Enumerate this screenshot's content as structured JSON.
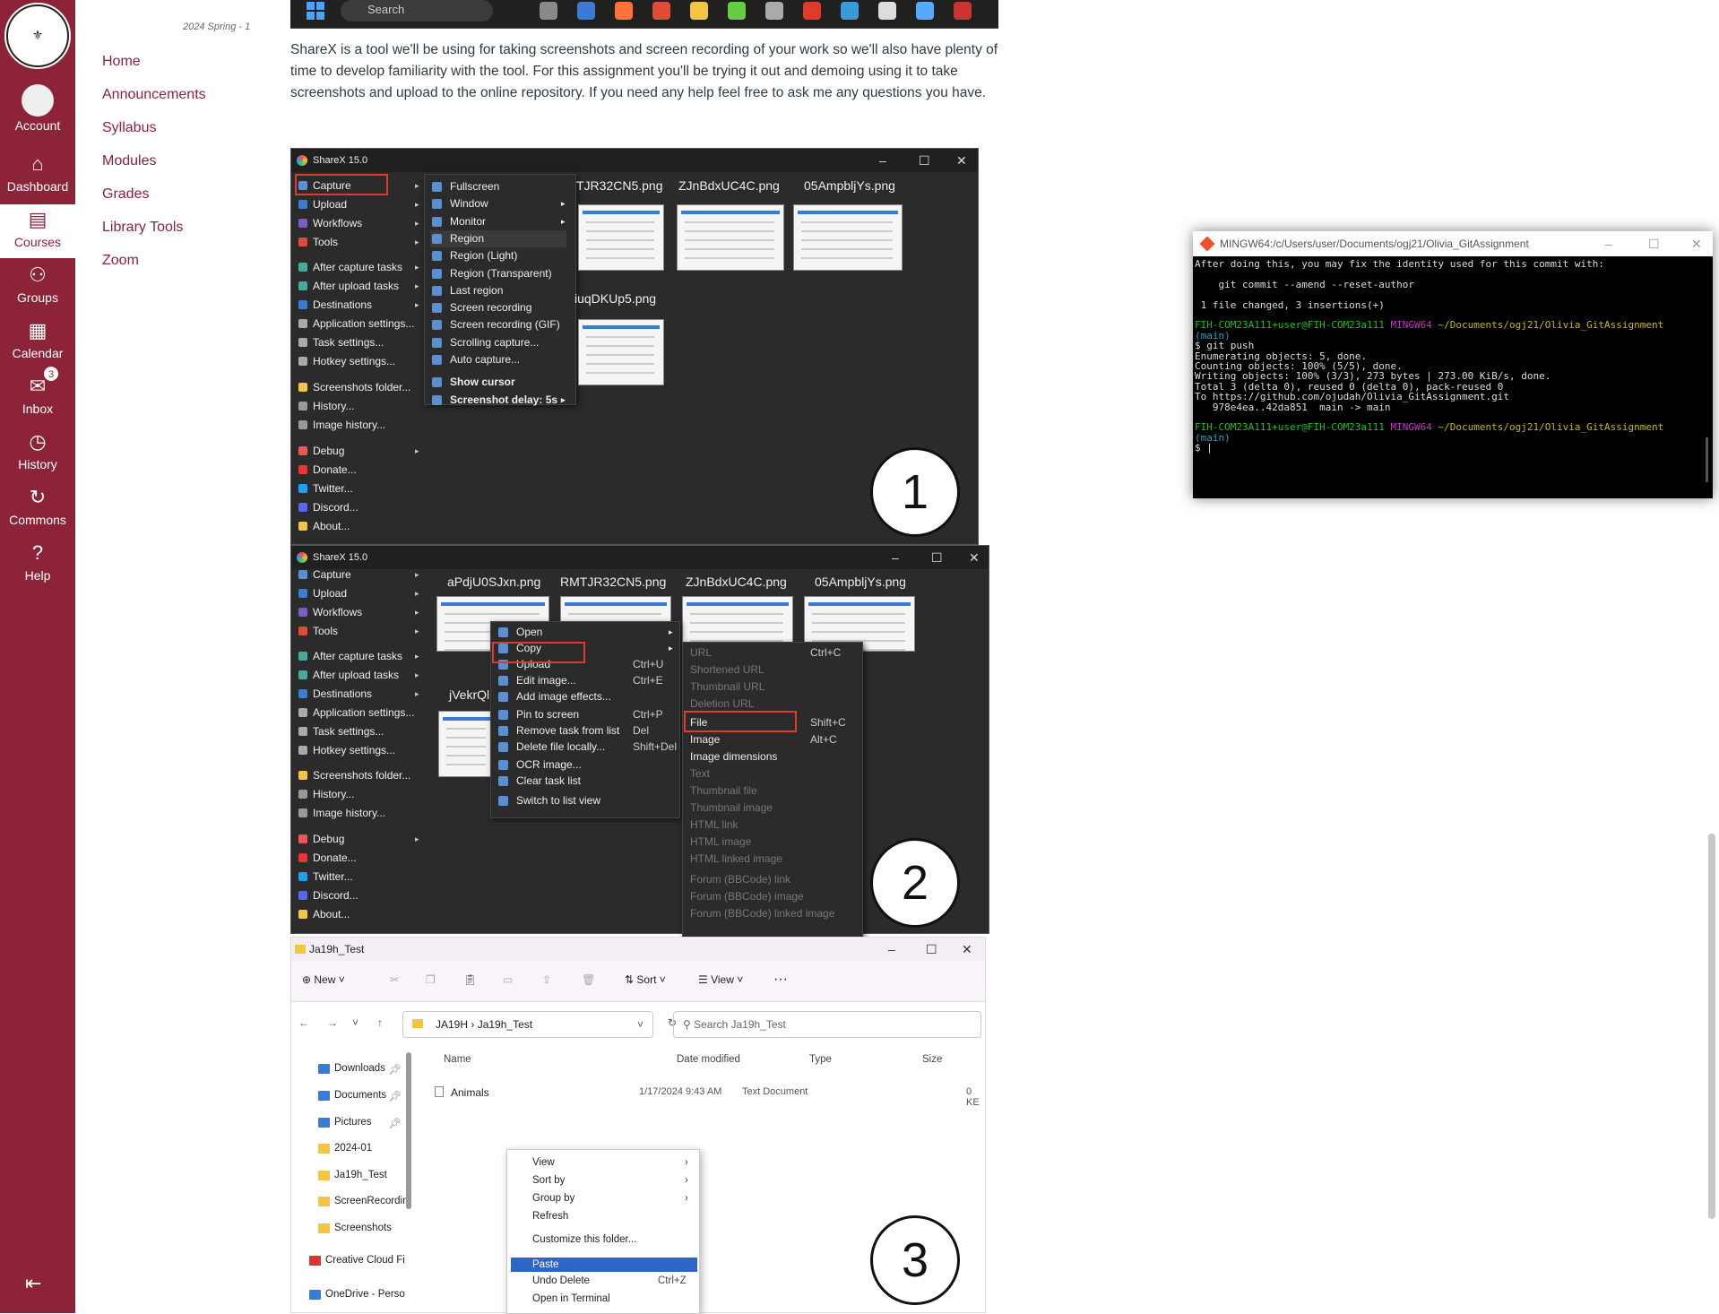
{
  "global_nav": {
    "items": [
      {
        "label": "Account",
        "icon": "account-icon"
      },
      {
        "label": "Dashboard",
        "icon": "dashboard-icon"
      },
      {
        "label": "Courses",
        "icon": "courses-icon"
      },
      {
        "label": "Groups",
        "icon": "groups-icon"
      },
      {
        "label": "Calendar",
        "icon": "calendar-icon"
      },
      {
        "label": "Inbox",
        "icon": "inbox-icon",
        "badge": "3"
      },
      {
        "label": "History",
        "icon": "history-icon"
      },
      {
        "label": "Commons",
        "icon": "commons-icon"
      },
      {
        "label": "Help",
        "icon": "help-icon"
      }
    ],
    "brand_color": "#8c2338"
  },
  "course_nav": {
    "term": "2024 Spring - 1",
    "links": [
      "Home",
      "Announcements",
      "Syllabus",
      "Modules",
      "Grades",
      "Library Tools",
      "Zoom"
    ]
  },
  "taskbar": {
    "search": "Search"
  },
  "intro": "ShareX is a tool we'll be using for taking screenshots and screen recording of your work so we'll also have plenty of time to develop familiarity with the tool. For this assignment you'll be trying it out and demoing using it to take screenshots and upload to the online repository. If you need any help feel free to ask me any questions you have.",
  "sharex1": {
    "title": "ShareX 15.0",
    "menu": [
      "Capture",
      "Upload",
      "Workflows",
      "Tools",
      "After capture tasks",
      "After upload tasks",
      "Destinations",
      "Application settings...",
      "Task settings...",
      "Hotkey settings...",
      "Screenshots folder...",
      "History...",
      "Image history...",
      "Debug",
      "Donate...",
      "Twitter...",
      "Discord...",
      "About..."
    ],
    "submenu": [
      "Fullscreen",
      "Window",
      "Monitor",
      "Region",
      "Region (Light)",
      "Region (Transparent)",
      "Last region",
      "Screen recording",
      "Screen recording (GIF)",
      "Scrolling capture...",
      "Auto capture...",
      "Show cursor",
      "Screenshot delay: 5s"
    ],
    "thumbs": [
      "TJR32CN5.png",
      "ZJnBdxUC4C.png",
      "05AmpbljYs.png",
      "iuqDKUp5.png"
    ],
    "number": "1"
  },
  "sharex2": {
    "title": "ShareX 15.0",
    "thumbs": [
      "aPdjU0SJxn.png",
      "RMTJR32CN5.png",
      "ZJnBdxUC4C.png",
      "05AmpbljYs.png",
      "jVekrQl"
    ],
    "context": [
      {
        "label": "Open",
        "sc": ""
      },
      {
        "label": "Copy",
        "sc": ""
      },
      {
        "label": "Upload",
        "sc": "Ctrl+U"
      },
      {
        "label": "Edit image...",
        "sc": "Ctrl+E"
      },
      {
        "label": "Add image effects...",
        "sc": ""
      },
      {
        "label": "Pin to screen",
        "sc": "Ctrl+P"
      },
      {
        "label": "Remove task from list",
        "sc": "Del"
      },
      {
        "label": "Delete file locally...",
        "sc": "Shift+Del"
      },
      {
        "label": "OCR image...",
        "sc": ""
      },
      {
        "label": "Clear task list",
        "sc": ""
      },
      {
        "label": "Switch to list view",
        "sc": ""
      }
    ],
    "copy_sub": [
      {
        "label": "URL",
        "sc": "Ctrl+C",
        "dis": true
      },
      {
        "label": "Shortened URL",
        "sc": "",
        "dis": true
      },
      {
        "label": "Thumbnail URL",
        "sc": "",
        "dis": true
      },
      {
        "label": "Deletion URL",
        "sc": "",
        "dis": true
      },
      {
        "label": "File",
        "sc": "Shift+C",
        "dis": false
      },
      {
        "label": "Image",
        "sc": "Alt+C",
        "dis": false
      },
      {
        "label": "Image dimensions",
        "sc": "",
        "dis": false
      },
      {
        "label": "Text",
        "sc": "",
        "dis": true
      },
      {
        "label": "Thumbnail file",
        "sc": "",
        "dis": true
      },
      {
        "label": "Thumbnail image",
        "sc": "",
        "dis": true
      },
      {
        "label": "HTML link",
        "sc": "",
        "dis": true
      },
      {
        "label": "HTML image",
        "sc": "",
        "dis": true
      },
      {
        "label": "HTML linked image",
        "sc": "",
        "dis": true
      },
      {
        "label": "Forum (BBCode) link",
        "sc": "",
        "dis": true
      },
      {
        "label": "Forum (BBCode) image",
        "sc": "",
        "dis": true
      },
      {
        "label": "Forum (BBCode) linked image",
        "sc": "",
        "dis": true
      }
    ],
    "number": "2"
  },
  "explorer": {
    "title": "Ja19h_Test",
    "toolbar": {
      "new": "New",
      "sort": "Sort",
      "view": "View"
    },
    "path": [
      "JA19H",
      "Ja19h_Test"
    ],
    "search": "Search Ja19h_Test",
    "nav": [
      "Downloads",
      "Documents",
      "Pictures",
      "2024-01",
      "Ja19h_Test",
      "ScreenRecordin",
      "Screenshots",
      "Creative Cloud Fi",
      "OneDrive - Perso"
    ],
    "columns": [
      "Name",
      "Date modified",
      "Type",
      "Size"
    ],
    "row": {
      "name": "Animals",
      "date": "1/17/2024 9:43 AM",
      "type": "Text Document",
      "size": "0 KE"
    },
    "context": [
      {
        "label": "View",
        "sc": "›"
      },
      {
        "label": "Sort by",
        "sc": "›"
      },
      {
        "label": "Group by",
        "sc": "›"
      },
      {
        "label": "Refresh",
        "sc": ""
      },
      {
        "label": "Customize this folder...",
        "sc": ""
      },
      {
        "label": "Paste",
        "sc": ""
      },
      {
        "label": "Undo Delete",
        "sc": "Ctrl+Z"
      },
      {
        "label": "Open in Terminal",
        "sc": ""
      }
    ],
    "number": "3"
  },
  "terminal": {
    "title": "MINGW64:/c/Users/user/Documents/ogj21/Olivia_GitAssignment",
    "lines": [
      {
        "t": "After doing this, you may fix the identity used for this commit with:",
        "c": ""
      },
      {
        "t": "",
        "c": ""
      },
      {
        "t": "    git commit --amend --reset-author",
        "c": ""
      },
      {
        "t": "",
        "c": ""
      },
      {
        "t": " 1 file changed, 3 insertions(+)",
        "c": ""
      },
      {
        "t": "",
        "c": ""
      },
      {
        "t": "FIH-COM23A111+user@FIH-COM23a111",
        "c": "g",
        "t2": " MINGW64",
        "c2": "m",
        "t3": " ~/Documents/ogj21/Olivia_GitAssignment",
        "c3": "y"
      },
      {
        "t": "(main)",
        "c": "c"
      },
      {
        "t": "$ git push",
        "c": ""
      },
      {
        "t": "Enumerating objects: 5, done.",
        "c": ""
      },
      {
        "t": "Counting objects: 100% (5/5), done.",
        "c": ""
      },
      {
        "t": "Writing objects: 100% (3/3), 273 bytes | 273.00 KiB/s, done.",
        "c": ""
      },
      {
        "t": "Total 3 (delta 0), reused 0 (delta 0), pack-reused 0",
        "c": ""
      },
      {
        "t": "To https://github.com/ojudah/Olivia_GitAssignment.git",
        "c": ""
      },
      {
        "t": "   978e4ea..42da851  main -> main",
        "c": ""
      },
      {
        "t": "",
        "c": ""
      },
      {
        "t": "FIH-COM23A111+user@FIH-COM23a111",
        "c": "g",
        "t2": " MINGW64",
        "c2": "m",
        "t3": " ~/Documents/ogj21/Olivia_GitAssignment",
        "c3": "y"
      },
      {
        "t": "(main)",
        "c": "c"
      },
      {
        "t": "$ |",
        "c": ""
      }
    ]
  }
}
